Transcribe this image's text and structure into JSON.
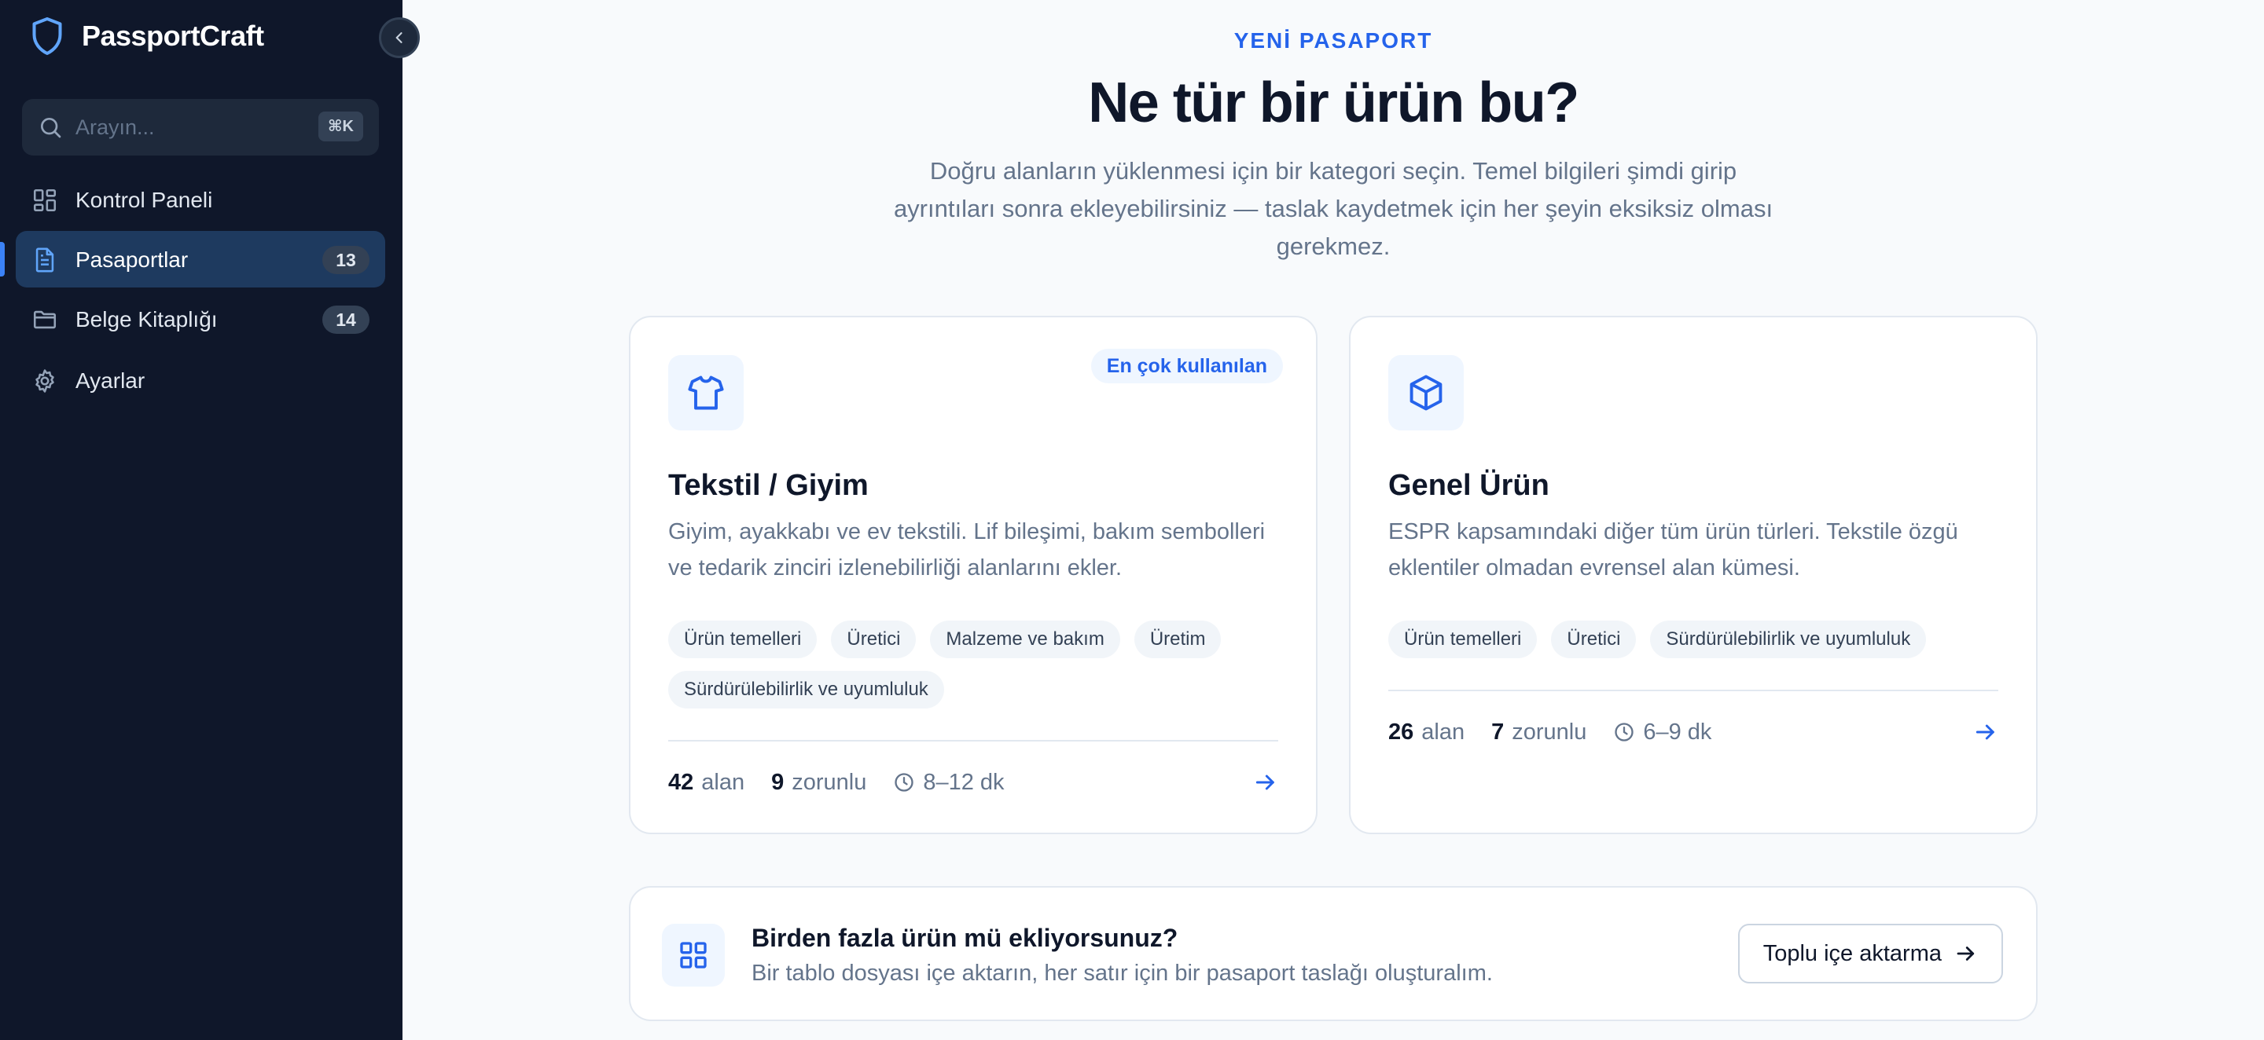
{
  "app": {
    "name": "PassportCraft"
  },
  "sidebar": {
    "search": {
      "placeholder": "Arayın...",
      "shortcut": "⌘K"
    },
    "items": [
      {
        "label": "Kontrol Paneli",
        "icon": "dashboard-icon",
        "count": null,
        "active": false
      },
      {
        "label": "Pasaportlar",
        "icon": "document-icon",
        "count": "13",
        "active": true
      },
      {
        "label": "Belge Kitaplığı",
        "icon": "folder-icon",
        "count": "14",
        "active": false
      },
      {
        "label": "Ayarlar",
        "icon": "gear-icon",
        "count": null,
        "active": false
      }
    ]
  },
  "main": {
    "eyebrow": "YENİ PASAPORT",
    "title": "Ne tür bir ürün bu?",
    "subtitle": "Doğru alanların yüklenmesi için bir kategori seçin. Temel bilgileri şimdi girip ayrıntıları sonra ekleyebilirsiniz — taslak kaydetmek için her şeyin eksiksiz olması gerekmez.",
    "cards": [
      {
        "icon": "shirt-icon",
        "badge": "En çok kullanılan",
        "title": "Tekstil / Giyim",
        "description": "Giyim, ayakkabı ve ev tekstili. Lif bileşimi, bakım sembolleri ve tedarik zinciri izlenebilirliği alanlarını ekler.",
        "tags": [
          "Ürün temelleri",
          "Üretici",
          "Malzeme ve bakım",
          "Üretim",
          "Sürdürülebilirlik ve uyumluluk"
        ],
        "fields": "42",
        "fields_label": "alan",
        "required": "9",
        "required_label": "zorunlu",
        "time": "8–12 dk"
      },
      {
        "icon": "box-icon",
        "badge": null,
        "title": "Genel Ürün",
        "description": "ESPR kapsamındaki diğer tüm ürün türleri. Tekstile özgü eklentiler olmadan evrensel alan kümesi.",
        "tags": [
          "Ürün temelleri",
          "Üretici",
          "Sürdürülebilirlik ve uyumluluk"
        ],
        "fields": "26",
        "fields_label": "alan",
        "required": "7",
        "required_label": "zorunlu",
        "time": "6–9 dk"
      }
    ],
    "bulk": {
      "icon": "grid-icon",
      "title": "Birden fazla ürün mü ekliyorsunuz?",
      "subtitle": "Bir tablo dosyası içe aktarın, her satır için bir pasaport taslağı oluşturalım.",
      "button": "Toplu içe aktarma"
    }
  },
  "colors": {
    "sidebar_bg": "#0f172a",
    "accent": "#2563eb",
    "active_item_bg": "#1e3a5f",
    "page_bg": "#f8fafc"
  }
}
